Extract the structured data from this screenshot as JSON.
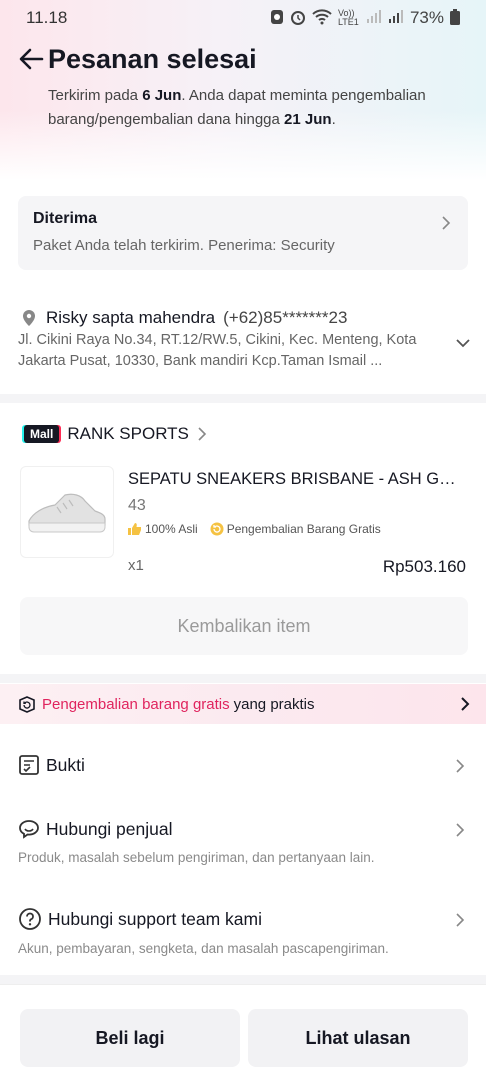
{
  "status_bar": {
    "time": "11.18",
    "network": "Vo)) LTE1",
    "battery": "73%"
  },
  "header": {
    "title": "Pesanan selesai",
    "subtitle_part1": "Terkirim pada ",
    "subtitle_date1": "6 Jun",
    "subtitle_part2": ". Anda dapat meminta pengembalian barang/pengembalian dana hingga ",
    "subtitle_date2": "21 Jun",
    "subtitle_part3": "."
  },
  "delivery": {
    "status": "Diterima",
    "detail": "Paket Anda telah terkirim. Penerima: Security"
  },
  "address": {
    "name": "Risky sapta mahendra",
    "phone": "(+62)85*******23",
    "text": "Jl. Cikini Raya No.34, RT.12/RW.5, Cikini, Kec. Menteng, Kota Jakarta Pusat, 10330, Bank mandiri Kcp.Taman Ismail ..."
  },
  "shop": {
    "badge": "Mall",
    "name": "RANK SPORTS"
  },
  "product": {
    "title": "SEPATU SNEAKERS BRISBANE - ASH GREY",
    "variant": "43",
    "badge_authentic": "100% Asli",
    "badge_free_return": "Pengembalian Barang Gratis",
    "quantity": "x1",
    "price": "Rp503.160"
  },
  "return_button": "Kembalikan item",
  "promo": {
    "highlight": "Pengembalian barang gratis",
    "rest": "yang praktis"
  },
  "menu": {
    "proof": {
      "title": "Bukti"
    },
    "contact_seller": {
      "title": "Hubungi penjual",
      "desc": "Produk, masalah sebelum pengiriman, dan pertanyaan lain."
    },
    "contact_support": {
      "title": "Hubungi support team kami",
      "desc": "Akun, pembayaran, sengketa, dan masalah pascapengiriman."
    }
  },
  "bottom": {
    "buy_again": "Beli lagi",
    "view_reviews": "Lihat ulasan"
  },
  "colors": {
    "accent": "#e0245e",
    "text": "#161823",
    "card_bg": "#f5f5f7"
  }
}
